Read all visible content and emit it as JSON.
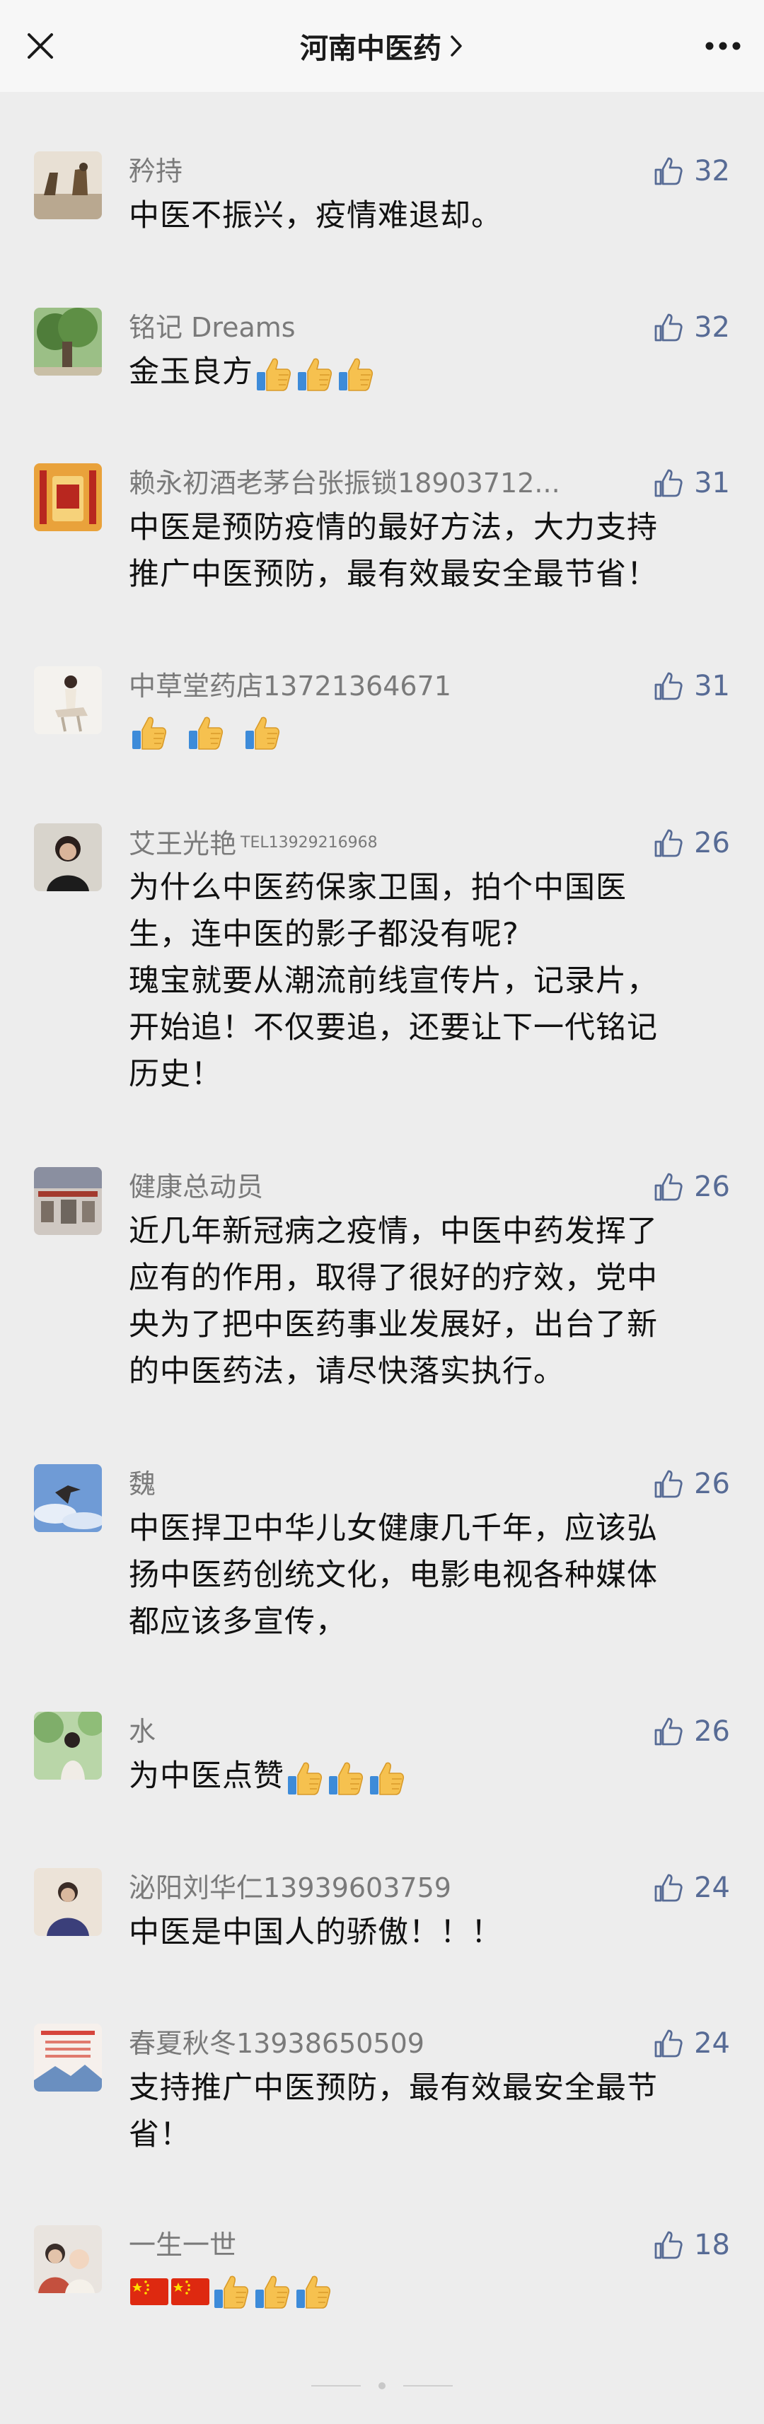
{
  "header": {
    "title": "河南中医药",
    "close_icon": "close-icon",
    "chevron_icon": "chevron-right-icon",
    "more_icon": "more-icon"
  },
  "comments": [
    {
      "nickname": "矜持",
      "likes": "32",
      "text": "中医不振兴，疫情难退却。",
      "emoji": []
    },
    {
      "nickname": "铭记 Dreams",
      "likes": "32",
      "text": "金玉良方",
      "emoji": [
        "thumbs-up",
        "thumbs-up",
        "thumbs-up"
      ]
    },
    {
      "nickname": "赖永初酒老茅台张振锁18903712...",
      "likes": "31",
      "text": "中医是预防疫情的最好方法，大力支持\n推广中医预防，最有效最安全最节省！",
      "emoji": []
    },
    {
      "nickname": "中草堂药店13721364671",
      "likes": "31",
      "text": "",
      "emoji": [
        "thumbs-up",
        "thumbs-up",
        "thumbs-up"
      ]
    },
    {
      "nickname": "艾王光艳",
      "nickname_sup": "TEL13929216968",
      "likes": "26",
      "text": "为什么中医药保家卫国，拍个中国医\n生，连中医的影子都没有呢?\n瑰宝就要从潮流前线宣传片，记录片，\n开始追！不仅要追，还要让下一代铭记\n历史！",
      "emoji": []
    },
    {
      "nickname": "健康总动员",
      "likes": "26",
      "text": "近几年新冠病之疫情，中医中药发挥了\n应有的作用，取得了很好的疗效，党中\n央为了把中医药事业发展好，出台了新\n的中医药法，请尽快落实执行。",
      "emoji": []
    },
    {
      "nickname": "魏",
      "likes": "26",
      "text": "中医捍卫中华儿女健康几千年，应该弘\n扬中医药创统文化，电影电视各种媒体\n都应该多宣传，",
      "emoji": []
    },
    {
      "nickname": "水",
      "likes": "26",
      "text": "为中医点赞",
      "emoji": [
        "thumbs-up",
        "thumbs-up",
        "thumbs-up"
      ]
    },
    {
      "nickname": "泌阳刘华仁13939603759",
      "likes": "24",
      "text": "中医是中国人的骄傲！！！",
      "emoji": []
    },
    {
      "nickname": "春夏秋冬13938650509",
      "likes": "24",
      "text": "支持推广中医预防，最有效最安全最节\n省！",
      "emoji": []
    },
    {
      "nickname": "一生一世",
      "likes": "18",
      "text": "",
      "emoji": [
        "china-flag",
        "china-flag",
        "thumbs-up",
        "thumbs-up",
        "thumbs-up"
      ]
    }
  ],
  "colors": {
    "background": "#ededed",
    "link_blue": "#576b95",
    "nickname_gray": "#7a7a7a"
  }
}
